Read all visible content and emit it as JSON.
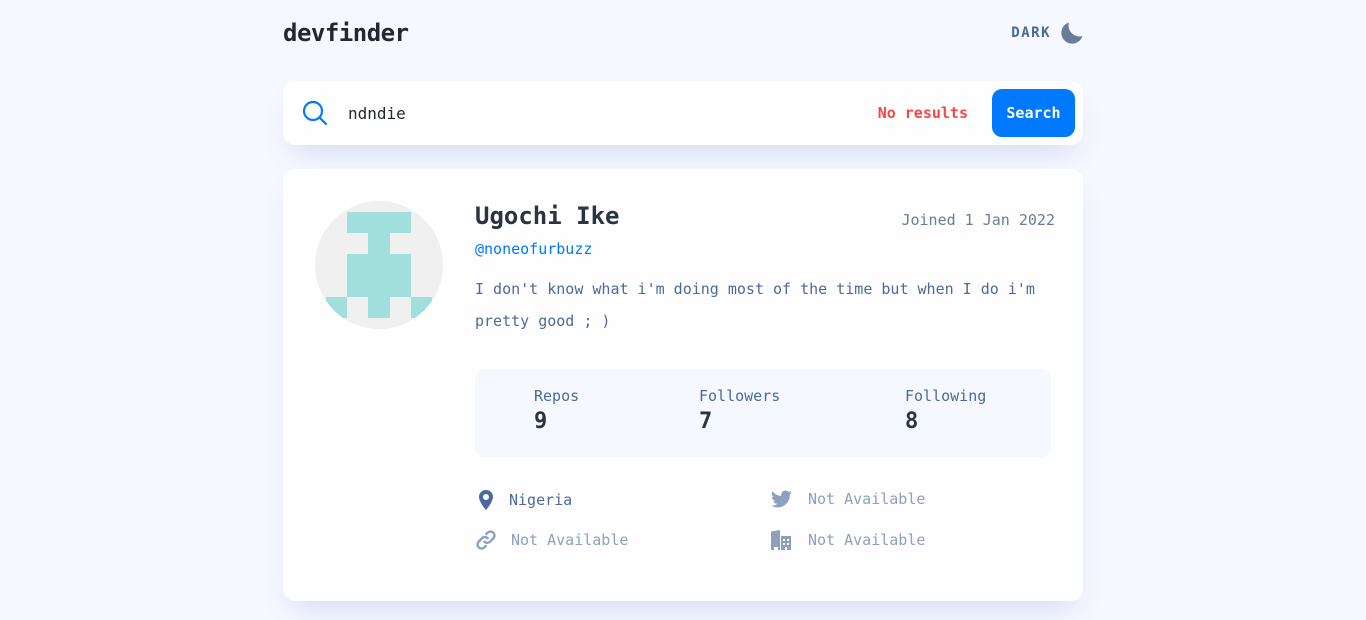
{
  "app": {
    "logo": "devfinder"
  },
  "theme_toggle": {
    "label": "DARK",
    "icon": "moon-icon"
  },
  "search": {
    "value": "ndndie",
    "error": "No results",
    "button_label": "Search"
  },
  "profile": {
    "name": "Ugochi Ike",
    "username": "@noneofurbuzz",
    "joined": "Joined 1 Jan 2022",
    "bio": "I don't know what i'm doing most of the time but when I do i'm pretty good ; )",
    "stats": [
      {
        "label": "Repos",
        "value": "9"
      },
      {
        "label": "Followers",
        "value": "7"
      },
      {
        "label": "Following",
        "value": "8"
      }
    ],
    "links": {
      "location": "Nigeria",
      "twitter": "Not Available",
      "website": "Not Available",
      "company": "Not Available"
    }
  },
  "colors": {
    "accent": "#0079ff",
    "error": "#f74646",
    "avatar_fg": "#a0dfdc",
    "avatar_bg": "#f0f0f0"
  }
}
